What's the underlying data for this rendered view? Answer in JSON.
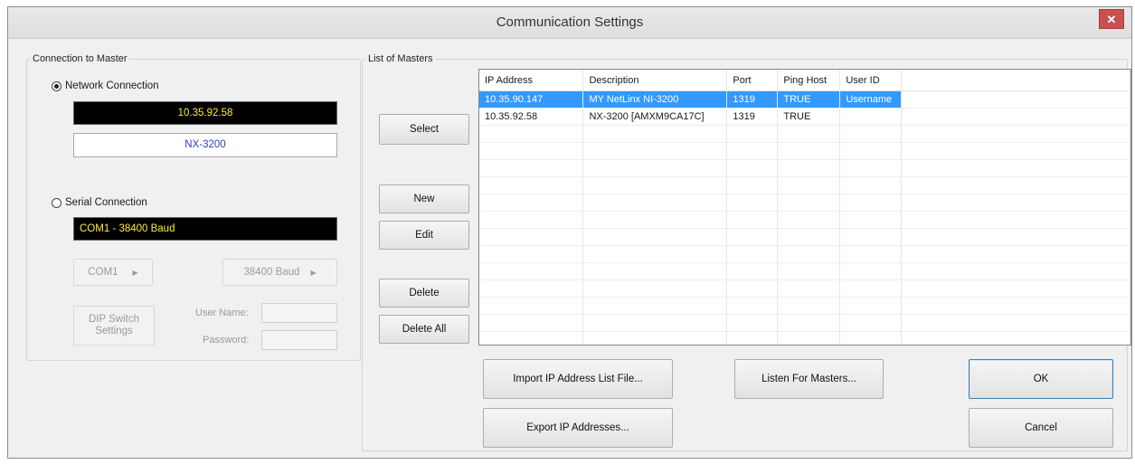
{
  "window": {
    "title": "Communication Settings",
    "close_label": "✕"
  },
  "connection": {
    "group_label": "Connection to Master",
    "network_label": "Network Connection",
    "network_ip": "10.35.92.58",
    "network_name": "NX-3200",
    "serial_label": "Serial Connection",
    "serial_value": "COM1 - 38400 Baud",
    "com_button": "COM1",
    "baud_button": "38400 Baud",
    "dip_button": "DIP Switch Settings",
    "username_label": "User Name:",
    "password_label": "Password:",
    "selected": "network"
  },
  "masters": {
    "group_label": "List of Masters",
    "select_label": "Select",
    "new_label": "New",
    "edit_label": "Edit",
    "delete_label": "Delete",
    "delete_all_label": "Delete All",
    "columns": [
      "IP Address",
      "Description",
      "Port",
      "Ping Host",
      "User ID"
    ],
    "rows": [
      [
        "10.35.90.147",
        "MY NetLinx NI-3200",
        "1319",
        "TRUE",
        "Username"
      ],
      [
        "10.35.92.58",
        "NX-3200 [AMXM9CA17C]",
        "1319",
        "TRUE",
        ""
      ]
    ],
    "selected_row": 0,
    "empty_rows": 13
  },
  "footer": {
    "import_label": "Import IP Address List File...",
    "export_label": "Export IP Addresses...",
    "listen_label": "Listen For Masters...",
    "ok_label": "OK",
    "cancel_label": "Cancel"
  },
  "colors": {
    "selection": "#3399ff",
    "ip_text": "#ffeb3b",
    "serial_text": "#ffeb3b",
    "name_text": "#2a3ac8",
    "close_bg": "#c75050"
  }
}
